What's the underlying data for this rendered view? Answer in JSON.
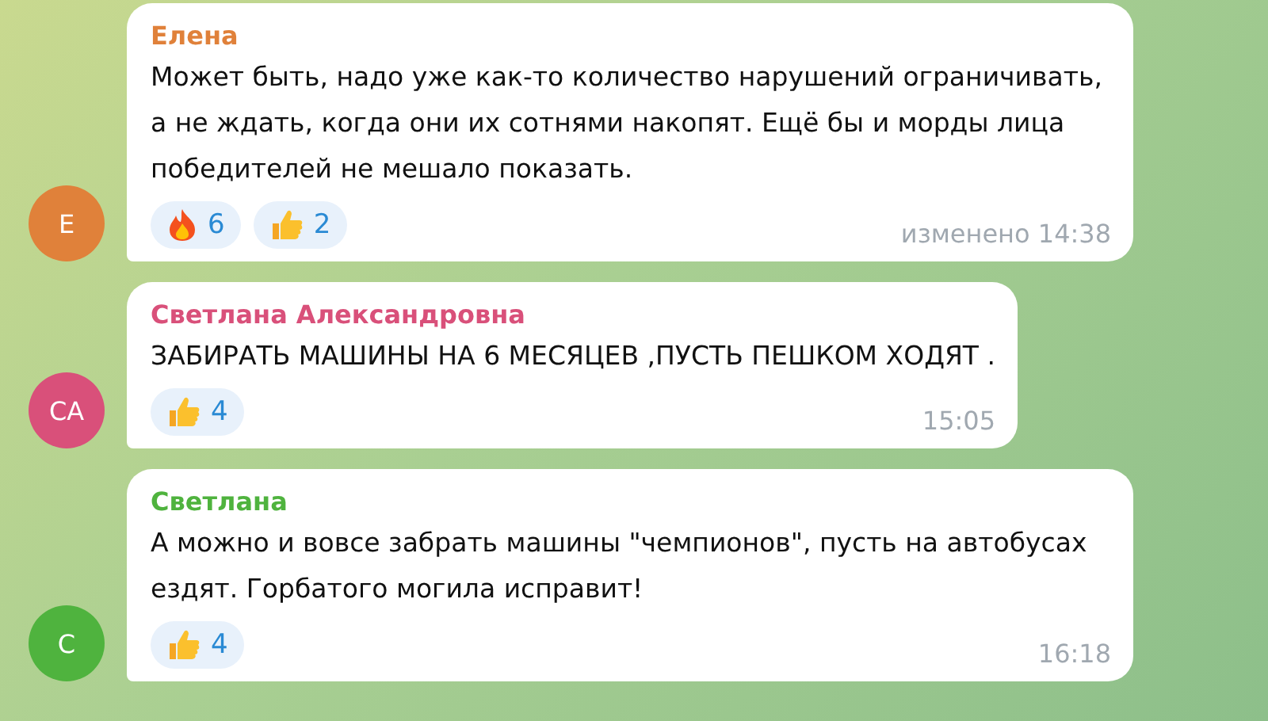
{
  "messages": [
    {
      "author": "Елена",
      "initials": "Е",
      "color": "#e0813a",
      "text": "Может быть, надо уже как-то количество нарушений ограничивать, а не ждать, когда они их сотнями накопят. Ещё бы и морды лица победителей не мешало показать.",
      "reactions": [
        {
          "kind": "fire",
          "count": "6"
        },
        {
          "kind": "thumbs",
          "count": "2"
        }
      ],
      "time": "изменено 14:38"
    },
    {
      "author": "Светлана Александровна",
      "initials": "СА",
      "color": "#d9507a",
      "text": "ЗАБИРАТЬ МАШИНЫ НА 6 МЕСЯЦЕВ ,ПУСТЬ ПЕШКОМ ХОДЯТ .",
      "reactions": [
        {
          "kind": "thumbs",
          "count": "4"
        }
      ],
      "time": "15:05"
    },
    {
      "author": "Светлана",
      "initials": "С",
      "color": "#4fb33e",
      "text": "А можно и вовсе забрать машины \"чемпионов\", пусть на автобусах ездят. Горбатого могила исправит!",
      "reactions": [
        {
          "kind": "thumbs",
          "count": "4"
        }
      ],
      "time": "16:18"
    }
  ]
}
